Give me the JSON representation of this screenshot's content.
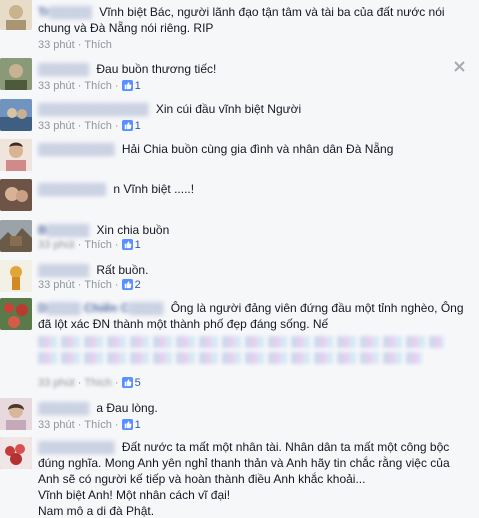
{
  "time_label": "33 phút",
  "like_action": "Thích",
  "comments": [
    {
      "author_mask": "Tr▒▒▒▒▒",
      "text": "Vĩnh biệt Bác, người lãnh đạo tận tâm và tài ba của đất nước nói chung và Đà Nẵng nói riêng. RIP",
      "likes": "",
      "avatar_color": "#d8d0c0"
    },
    {
      "author_mask": "▒▒▒▒▒▒",
      "text": "Đau buồn thương tiếc!",
      "likes": "1",
      "avatar_color": "#6b7a5a"
    },
    {
      "author_mask": "▒▒▒▒▒▒▒▒▒▒▒▒▒",
      "text": "Xin cúi đầu vĩnh biệt Người",
      "likes": "1",
      "avatar_color": "#5b7fa8"
    },
    {
      "author_mask": "▒▒▒▒▒▒▒▒▒",
      "text": "Hải Chia buồn cùng gia đình và nhân dân Đà Nẵng",
      "likes": "",
      "avatar_color": "#c9a88a"
    },
    {
      "author_mask": "▒▒▒▒▒▒▒▒",
      "text": "n Vĩnh biệt .....!",
      "likes": "",
      "avatar_color": "#8a6a55"
    },
    {
      "author_mask": "B▒▒▒▒▒",
      "text": "Xin chia buồn",
      "likes": "1",
      "avatar_color": "#7a6b5a"
    },
    {
      "author_mask": "▒▒▒▒▒▒",
      "text": "Rất buồn.",
      "likes": "2",
      "avatar_color": "#e2a53a"
    },
    {
      "author_mask": "D▒▒▒▒ Chiến C▒▒▒▒",
      "text": "Ông là người đảng viên đứng đầu một tỉnh nghèo, Ông đã lột xác ĐN thành một thành phố đẹp đáng sống. Nế",
      "likes": "5",
      "avatar_color": "#a85a4a"
    },
    {
      "author_mask": "▒▒▒▒▒▒",
      "text": "a Đau lòng.",
      "likes": "1",
      "avatar_color": "#c7a8b8"
    },
    {
      "author_mask": "▒▒▒▒▒▒▒▒▒",
      "text": "Đất nước ta mất một nhân tài. Nhân dân ta mất một công bộc đúng nghĩa. Mong Anh yên nghỉ thanh thản và Anh hãy tin chắc rằng việc của Anh sẽ có người kế tiếp và hoàn thành điều Anh khắc khoải...\nVĩnh biệt Anh! Một nhân cách vĩ đại!\nNam mô a di đà Phật.",
      "likes": "",
      "avatar_color": "#c65a5a"
    }
  ],
  "close_icon": "close-icon"
}
